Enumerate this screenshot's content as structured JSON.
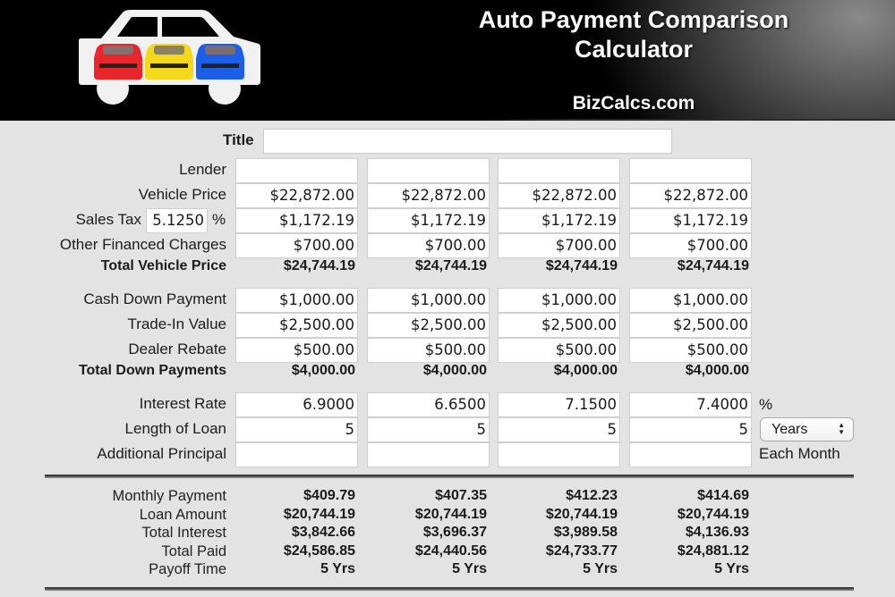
{
  "header": {
    "title_line1": "Auto Payment Comparison",
    "title_line2": "Calculator",
    "site": "BizCalcs.com",
    "logo": "car-logo-with-three-cars"
  },
  "form": {
    "title_label": "Title",
    "title_value": "",
    "labels": {
      "lender": "Lender",
      "vehicle_price": "Vehicle Price",
      "sales_tax": "Sales Tax",
      "sales_tax_unit": "%",
      "other_charges": "Other Financed Charges",
      "total_vehicle_price": "Total Vehicle Price",
      "cash_down": "Cash Down Payment",
      "trade_in": "Trade-In Value",
      "dealer_rebate": "Dealer Rebate",
      "total_down": "Total Down Payments",
      "interest_rate": "Interest Rate",
      "interest_unit": "%",
      "length_of_loan": "Length of Loan",
      "additional_principal": "Additional Principal",
      "additional_principal_unit": "Each Month"
    },
    "sales_tax_rate": "5.1250",
    "loan_term_unit": "Years",
    "columns": [
      {
        "lender": "",
        "vehicle_price": "$22,872.00",
        "sales_tax": "$1,172.19",
        "other_charges": "$700.00",
        "total_vehicle_price": "$24,744.19",
        "cash_down": "$1,000.00",
        "trade_in": "$2,500.00",
        "dealer_rebate": "$500.00",
        "total_down": "$4,000.00",
        "interest_rate": "6.9000",
        "length_of_loan": "5",
        "additional_principal": ""
      },
      {
        "lender": "",
        "vehicle_price": "$22,872.00",
        "sales_tax": "$1,172.19",
        "other_charges": "$700.00",
        "total_vehicle_price": "$24,744.19",
        "cash_down": "$1,000.00",
        "trade_in": "$2,500.00",
        "dealer_rebate": "$500.00",
        "total_down": "$4,000.00",
        "interest_rate": "6.6500",
        "length_of_loan": "5",
        "additional_principal": ""
      },
      {
        "lender": "",
        "vehicle_price": "$22,872.00",
        "sales_tax": "$1,172.19",
        "other_charges": "$700.00",
        "total_vehicle_price": "$24,744.19",
        "cash_down": "$1,000.00",
        "trade_in": "$2,500.00",
        "dealer_rebate": "$500.00",
        "total_down": "$4,000.00",
        "interest_rate": "7.1500",
        "length_of_loan": "5",
        "additional_principal": ""
      },
      {
        "lender": "",
        "vehicle_price": "$22,872.00",
        "sales_tax": "$1,172.19",
        "other_charges": "$700.00",
        "total_vehicle_price": "$24,744.19",
        "cash_down": "$1,000.00",
        "trade_in": "$2,500.00",
        "dealer_rebate": "$500.00",
        "total_down": "$4,000.00",
        "interest_rate": "7.4000",
        "length_of_loan": "5",
        "additional_principal": ""
      }
    ]
  },
  "results": {
    "labels": {
      "monthly_payment": "Monthly Payment",
      "loan_amount": "Loan Amount",
      "total_interest": "Total Interest",
      "total_paid": "Total Paid",
      "payoff_time": "Payoff Time"
    },
    "columns": [
      {
        "monthly_payment": "$409.79",
        "loan_amount": "$20,744.19",
        "total_interest": "$3,842.66",
        "total_paid": "$24,586.85",
        "payoff_time": "5 Yrs"
      },
      {
        "monthly_payment": "$407.35",
        "loan_amount": "$20,744.19",
        "total_interest": "$3,696.37",
        "total_paid": "$24,440.56",
        "payoff_time": "5 Yrs"
      },
      {
        "monthly_payment": "$412.23",
        "loan_amount": "$20,744.19",
        "total_interest": "$3,989.58",
        "total_paid": "$24,733.77",
        "payoff_time": "5 Yrs"
      },
      {
        "monthly_payment": "$414.69",
        "loan_amount": "$20,744.19",
        "total_interest": "$4,136.93",
        "total_paid": "$24,881.12",
        "payoff_time": "5 Yrs"
      }
    ]
  },
  "colors": {
    "header_bg": "#000000",
    "page_bg": "#e3e3e3",
    "car_red": "#e8262c",
    "car_yellow": "#f4d81c",
    "car_blue": "#1c5fe6"
  }
}
